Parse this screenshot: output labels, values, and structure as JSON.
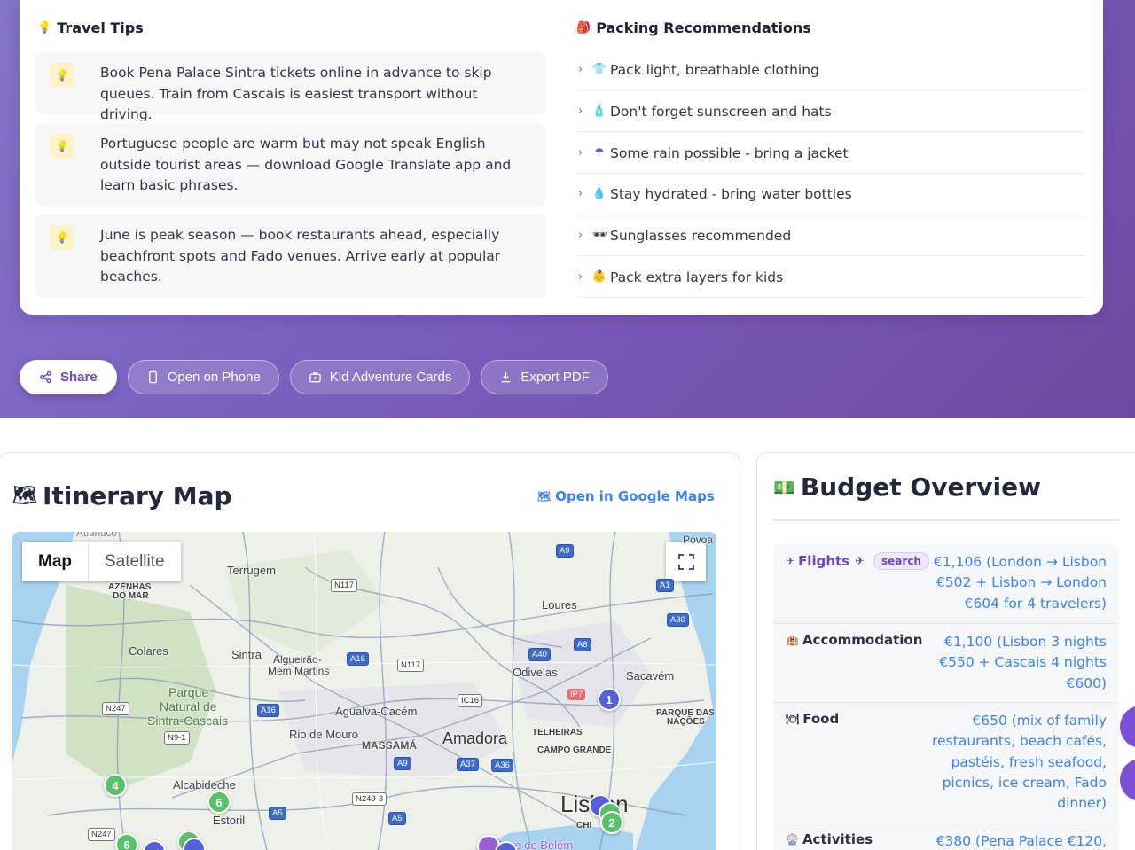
{
  "travel_tips": {
    "title": "Travel Tips",
    "title_icon": "lightbulb-icon",
    "items": [
      "Book Pena Palace Sintra tickets online in advance to skip queues. Train from Cascais is easiest transport without driving.",
      "Portuguese people are warm but may not speak English outside tourist areas — download Google Translate app and learn basic phrases.",
      "June is peak season — book restaurants ahead, especially beachfront spots and Fado venues. Arrive early at popular beaches."
    ]
  },
  "packing": {
    "title": "Packing Recommendations",
    "title_icon": "backpack-icon",
    "items": [
      {
        "icon": "👕",
        "icon_name": "shirt-icon",
        "text": "Pack light, breathable clothing"
      },
      {
        "icon": "🧴",
        "icon_name": "sunscreen-icon",
        "text": "Don't forget sunscreen and hats"
      },
      {
        "icon": "☂",
        "icon_name": "umbrella-icon",
        "text": "Some rain possible - bring a jacket"
      },
      {
        "icon": "💧",
        "icon_name": "water-drop-icon",
        "text": "Stay hydrated - bring water bottles"
      },
      {
        "icon": "🕶",
        "icon_name": "sunglasses-icon",
        "text": "Sunglasses recommended"
      },
      {
        "icon": "👶",
        "icon_name": "child-icon",
        "text": "Pack extra layers for kids"
      }
    ]
  },
  "actions": {
    "share": "Share",
    "open_phone": "Open on Phone",
    "kid_cards": "Kid Adventure Cards",
    "export_pdf": "Export PDF"
  },
  "itinerary_map": {
    "title": "Itinerary Map",
    "open_google_maps": "Open in Google Maps",
    "map_type": {
      "map": "Map",
      "satellite": "Satellite",
      "selected": "Map"
    },
    "place_labels": {
      "atlantico": "Atlântico",
      "povoa": "Póvoa",
      "terrugem": "Terrugem",
      "azenhas": "AZENHAS",
      "do_mar": "DO MAR",
      "loures": "Loures",
      "colares": "Colares",
      "sintra": "Sintra",
      "algueirao": "Algueirão-",
      "mem_martins": "Mem Martins",
      "odivelas": "Odivelas",
      "sacavem": "Sacavém",
      "parque1": "Parque",
      "parque2": "Natural de",
      "parque3": "Sintra-Cascais",
      "agualva": "Agualva-Cacém",
      "parque_nacoes1": "PARQUE DAS",
      "parque_nacoes2": "NAÇÕES",
      "rio_mouro": "Rio de Mouro",
      "massama": "MASSAMÁ",
      "amadora": "Amadora",
      "telheiras": "TELHEIRAS",
      "campo_grande": "CAMPO GRANDE",
      "alcabideche": "Alcabideche",
      "estoril": "Estoril",
      "lisbon": "Lisbon",
      "chi": "CHI",
      "belem": "Torre de Belém"
    },
    "roads": [
      "A9",
      "N117",
      "A1",
      "A30",
      "A8",
      "A16",
      "N117",
      "A40",
      "IP7",
      "N247",
      "A16",
      "IC16",
      "N9-1",
      "A9",
      "A37",
      "A36",
      "N249-3",
      "A5",
      "A5",
      "N247"
    ],
    "markers": [
      "1",
      "4",
      "6",
      "2",
      "6"
    ]
  },
  "budget": {
    "title": "Budget Overview",
    "title_icon": "money-icon",
    "rows": [
      {
        "label": "Flights",
        "icon_name": "airplane-icon",
        "badge": "search",
        "value": "€1,106 (London → Lisbon €502 + Lisbon → London €604 for 4 travelers)"
      },
      {
        "label": "Accommodation",
        "icon_name": "hotel-icon",
        "value": "€1,100 (Lisbon 3 nights €550 + Cascais 4 nights €600)"
      },
      {
        "label": "Food",
        "icon_name": "plate-icon",
        "value": "€650 (mix of family restaurants, beach cafés, pastéis, fresh seafood, picnics, ice cream, Fado dinner)"
      },
      {
        "label": "Activities",
        "icon_name": "ferris-wheel-icon",
        "value": "€380 (Pena Palace €120,"
      }
    ]
  },
  "colors": {
    "accent": "#6d45c4",
    "link": "#3b82f6",
    "hero_start": "#8574cc",
    "hero_end": "#6f4aa4"
  }
}
